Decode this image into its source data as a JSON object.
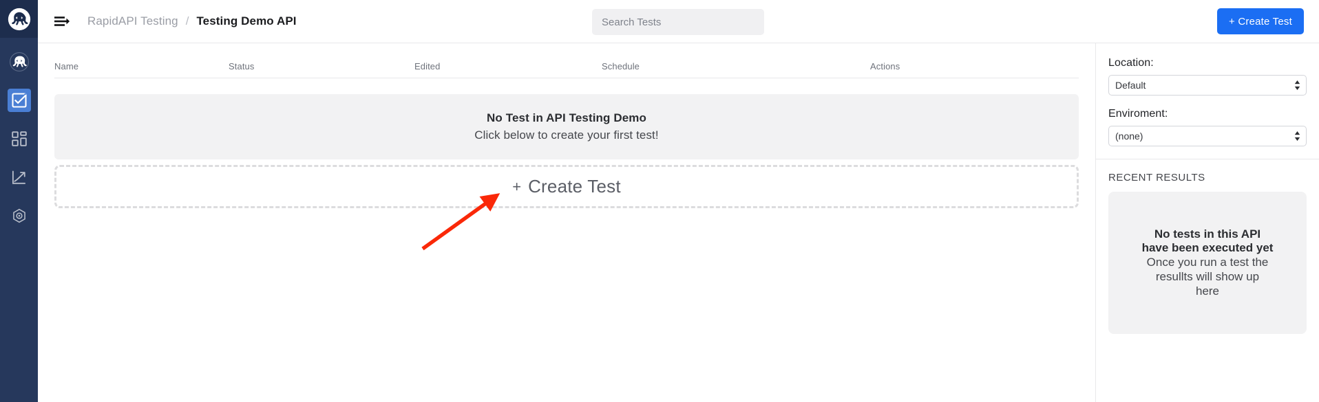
{
  "rail": {
    "logo_icon": "rapidapi-octopus-logo",
    "items": [
      {
        "name": "brandmark",
        "icon": "octopus-brand-icon",
        "active": false
      },
      {
        "name": "testing",
        "icon": "checked-box-icon",
        "active": true
      },
      {
        "name": "dashboard",
        "icon": "grid-squares-icon",
        "active": false
      },
      {
        "name": "analytics",
        "icon": "trend-up-chart-icon",
        "active": false
      },
      {
        "name": "settings",
        "icon": "hexagon-gear-icon",
        "active": false
      }
    ]
  },
  "topbar": {
    "menu_icon": "hamburger-arrow-icon",
    "breadcrumb": {
      "root": "RapidAPI Testing",
      "separator": "/",
      "current": "Testing Demo API"
    },
    "search": {
      "placeholder": "Search Tests",
      "value": ""
    },
    "create_test_label": "+ Create Test"
  },
  "table": {
    "columns": [
      "Name",
      "Status",
      "Edited",
      "Schedule",
      "Actions"
    ],
    "rows": []
  },
  "empty_state": {
    "title": "No Test in API Testing Demo",
    "subtitle": "Click below to create your first test!"
  },
  "create_drop": {
    "plus": "+",
    "label": "Create Test"
  },
  "right_panel": {
    "location_label": "Location:",
    "location_value": "Default",
    "location_options": [
      "Default"
    ],
    "environment_label": "Enviroment:",
    "environment_value": "(none)",
    "environment_options": [
      "(none)"
    ],
    "results_title": "RECENT RESULTS",
    "results_heading_line1": "No tests in this API",
    "results_heading_line2": "have been executed yet",
    "results_sub_line1": "Once you run a test the",
    "results_sub_line2": "resullts will show up",
    "results_sub_line3": "here"
  },
  "annotation": {
    "arrow_color": "#fa2808",
    "arrow_target": "create-test-drop-zone"
  },
  "colors": {
    "rail_bg": "#26385c",
    "rail_logo_bg": "#1d2d4d",
    "rail_active": "#4a7fd4",
    "accent_blue": "#1b6ef3",
    "empty_card_bg": "#f2f2f3",
    "border": "#e8e8ea",
    "annotation_red": "#fa2808"
  }
}
